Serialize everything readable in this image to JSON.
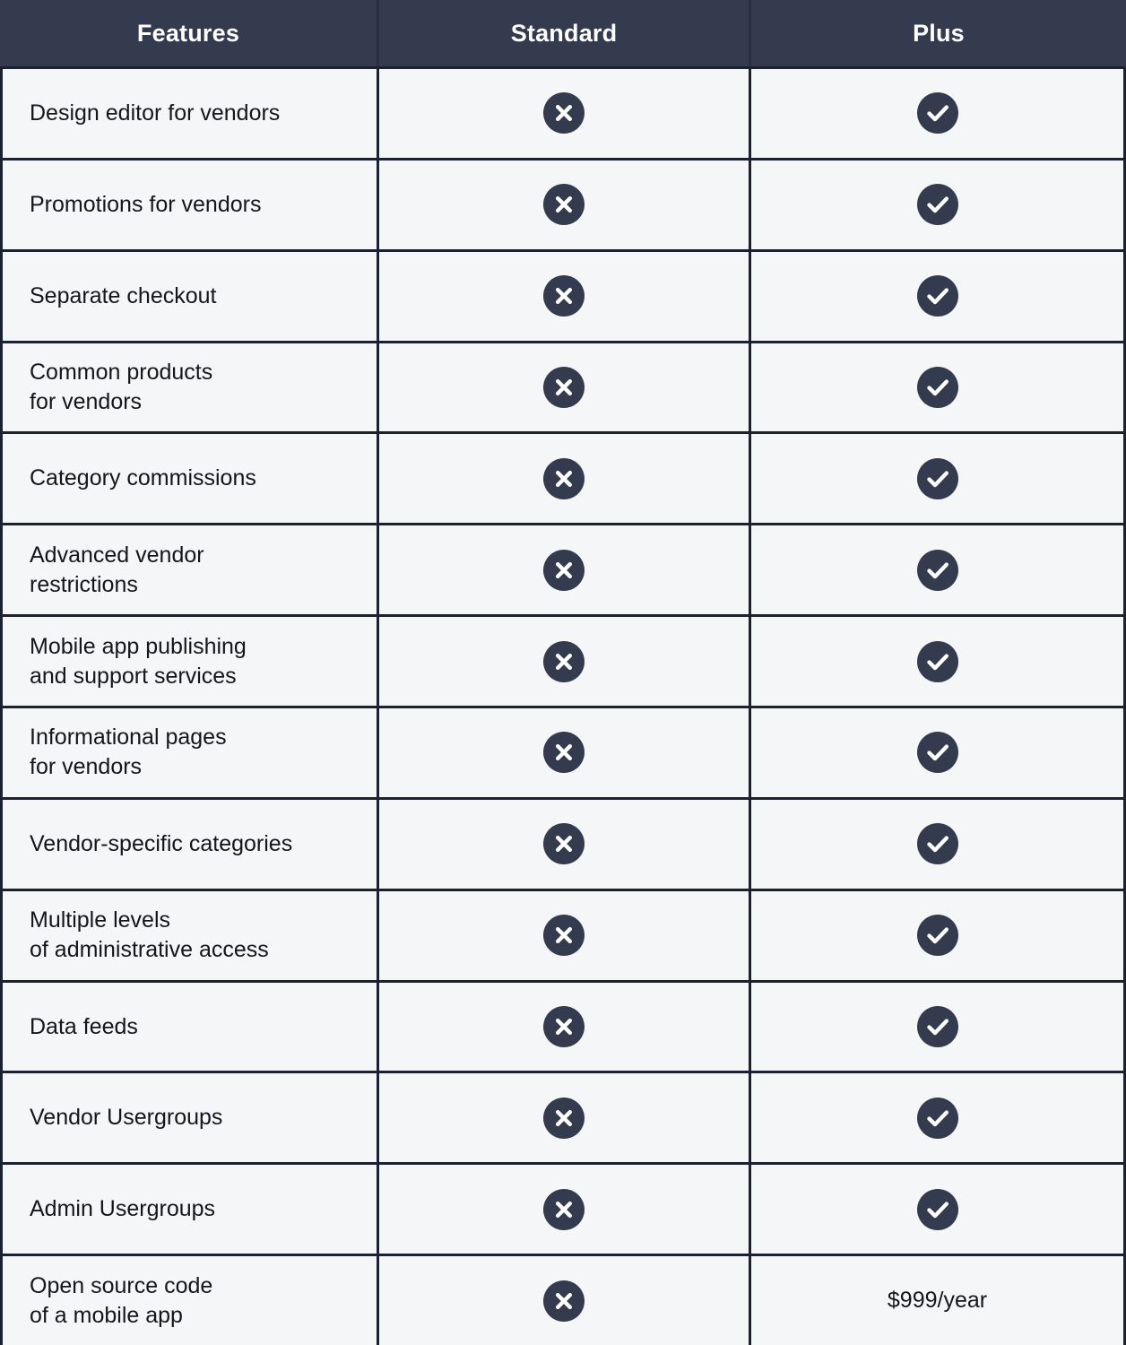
{
  "table": {
    "columns": [
      {
        "key": "features",
        "label": "Features"
      },
      {
        "key": "standard",
        "label": "Standard"
      },
      {
        "key": "plus",
        "label": "Plus"
      }
    ],
    "colors": {
      "header_background": "#343b4f",
      "header_text": "#ffffff",
      "row_background": "#f5f6f7",
      "border": "#1c2130",
      "icon_circle": "#343b4f",
      "icon_glyph": "#ffffff",
      "body_text": "#14161c"
    },
    "icons": {
      "included": "check-circle-icon",
      "excluded": "cross-circle-icon"
    },
    "rows": [
      {
        "feature": "Design editor for vendors",
        "standard": "excluded",
        "plus": "included"
      },
      {
        "feature": "Promotions for vendors",
        "standard": "excluded",
        "plus": "included"
      },
      {
        "feature": "Separate checkout",
        "standard": "excluded",
        "plus": "included"
      },
      {
        "feature": "Common products\nfor vendors",
        "standard": "excluded",
        "plus": "included"
      },
      {
        "feature": "Category commissions",
        "standard": "excluded",
        "plus": "included"
      },
      {
        "feature": "Advanced vendor\nrestrictions",
        "standard": "excluded",
        "plus": "included"
      },
      {
        "feature": "Mobile app publishing\nand support services",
        "standard": "excluded",
        "plus": "included"
      },
      {
        "feature": "Informational pages\nfor vendors",
        "standard": "excluded",
        "plus": "included"
      },
      {
        "feature": "Vendor-specific categories",
        "standard": "excluded",
        "plus": "included"
      },
      {
        "feature": "Multiple levels\nof administrative access",
        "standard": "excluded",
        "plus": "included"
      },
      {
        "feature": "Data feeds",
        "standard": "excluded",
        "plus": "included"
      },
      {
        "feature": "Vendor Usergroups",
        "standard": "excluded",
        "plus": "included"
      },
      {
        "feature": "Admin Usergroups",
        "standard": "excluded",
        "plus": "included"
      },
      {
        "feature": "Open source code\nof a mobile app",
        "standard": "excluded",
        "plus": "$999/year"
      }
    ]
  }
}
